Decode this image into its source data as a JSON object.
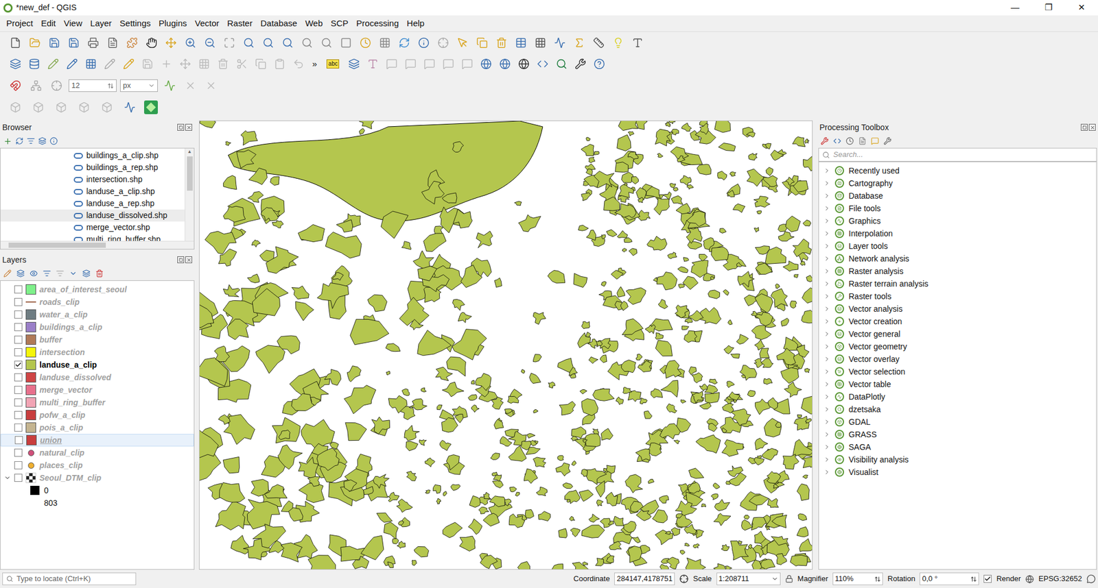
{
  "window": {
    "title": "*new_def - QGIS",
    "controls": [
      "—",
      "❐",
      "✕"
    ]
  },
  "menu": [
    "Project",
    "Edit",
    "View",
    "Layer",
    "Settings",
    "Plugins",
    "Vector",
    "Raster",
    "Database",
    "Web",
    "SCP",
    "Processing",
    "Help"
  ],
  "toolbar": {
    "overflow": "»",
    "label_tool": "abc",
    "snap_tolerance": "12",
    "snap_unit": "px"
  },
  "browser": {
    "title": "Browser",
    "items": [
      {
        "label": "buildings_a_clip.shp",
        "selected": false
      },
      {
        "label": "buildings_a_rep.shp",
        "selected": false
      },
      {
        "label": "intersection.shp",
        "selected": false
      },
      {
        "label": "landuse_a_clip.shp",
        "selected": false
      },
      {
        "label": "landuse_a_rep.shp",
        "selected": false
      },
      {
        "label": "landuse_dissolved.shp",
        "selected": true
      },
      {
        "label": "merge_vector.shp",
        "selected": false
      },
      {
        "label": "multi_ring_buffer.shp",
        "selected": false
      }
    ]
  },
  "layers": {
    "title": "Layers",
    "items": [
      {
        "name": "area_of_interest_seoul",
        "checked": false,
        "selected": false,
        "color": "#7ef08a",
        "kind": "fill"
      },
      {
        "name": "roads_clip",
        "checked": false,
        "selected": false,
        "color": "#a0664a",
        "kind": "line"
      },
      {
        "name": "water_a_clip",
        "checked": false,
        "selected": false,
        "color": "#6f7d82",
        "kind": "fill"
      },
      {
        "name": "buildings_a_clip",
        "checked": false,
        "selected": false,
        "color": "#9a7fc8",
        "kind": "fill"
      },
      {
        "name": "buffer",
        "checked": false,
        "selected": false,
        "color": "#b07a58",
        "kind": "fill"
      },
      {
        "name": "intersection",
        "checked": false,
        "selected": false,
        "color": "#f5f50a",
        "kind": "fill"
      },
      {
        "name": "landuse_a_clip",
        "checked": true,
        "selected": false,
        "color": "#b4c64e",
        "kind": "fill"
      },
      {
        "name": "landuse_dissolved",
        "checked": false,
        "selected": false,
        "color": "#cf4545",
        "kind": "fill"
      },
      {
        "name": "merge_vector",
        "checked": false,
        "selected": false,
        "color": "#e8708c",
        "kind": "fill"
      },
      {
        "name": "multi_ring_buffer",
        "checked": false,
        "selected": false,
        "color": "#f2a4b4",
        "kind": "fill"
      },
      {
        "name": "pofw_a_clip",
        "checked": false,
        "selected": false,
        "color": "#c83e3e",
        "kind": "fill"
      },
      {
        "name": "pois_a_clip",
        "checked": false,
        "selected": false,
        "color": "#c4b490",
        "kind": "fill"
      },
      {
        "name": "union",
        "checked": false,
        "selected": true,
        "color": "#c83e3e",
        "kind": "fill"
      },
      {
        "name": "natural_clip",
        "checked": false,
        "selected": false,
        "color": "#d0507a",
        "kind": "point"
      },
      {
        "name": "places_clip",
        "checked": false,
        "selected": false,
        "color": "#f0b030",
        "kind": "point"
      },
      {
        "name": "Seoul_DTM_clip",
        "checked": false,
        "selected": false,
        "color": "#888888",
        "kind": "raster",
        "expanded": true
      }
    ],
    "legend": [
      {
        "label": "0",
        "color": "#000000"
      },
      {
        "label": "803",
        "color": "#ffffff"
      }
    ]
  },
  "toolbox": {
    "title": "Processing Toolbox",
    "search_placeholder": "Search...",
    "items": [
      "Recently used",
      "Cartography",
      "Database",
      "File tools",
      "Graphics",
      "Interpolation",
      "Layer tools",
      "Network analysis",
      "Raster analysis",
      "Raster terrain analysis",
      "Raster tools",
      "Vector analysis",
      "Vector creation",
      "Vector general",
      "Vector geometry",
      "Vector overlay",
      "Vector selection",
      "Vector table",
      "DataPlotly",
      "dzetsaka",
      "GDAL",
      "GRASS",
      "SAGA",
      "Visibility analysis",
      "Visualist"
    ]
  },
  "status_bar": {
    "locator_placeholder": "Type to locate (Ctrl+K)",
    "coordinate_label": "Coordinate",
    "coordinate": "284147,4178751",
    "scale_label": "Scale",
    "scale": "1:208711",
    "magnifier_label": "Magnifier",
    "magnifier": "110%",
    "rotation_label": "Rotation",
    "rotation": "0,0 °",
    "render_label": "Render",
    "render": true,
    "crs": "EPSG:32652"
  }
}
